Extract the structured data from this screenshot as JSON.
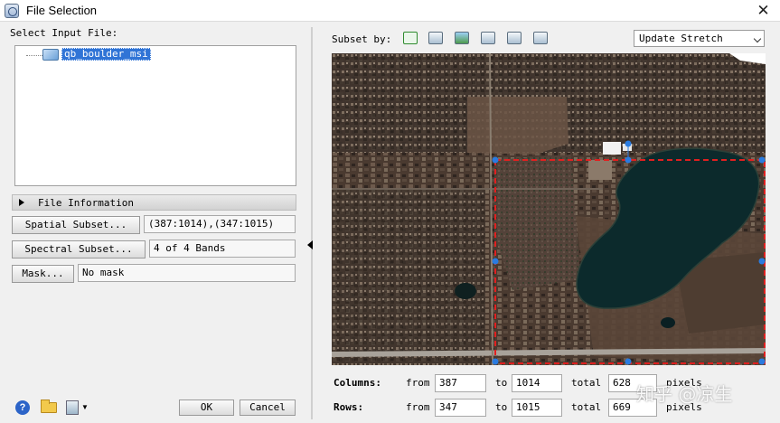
{
  "window": {
    "title": "File Selection",
    "close_glyph": "✕"
  },
  "left": {
    "select_label": "Select Input File:",
    "files": [
      "qb_boulder_msi"
    ],
    "file_info_label": "File Information",
    "spatial_button": "Spatial Subset...",
    "spatial_value": "(387:1014),(347:1015)",
    "spectral_button": "Spectral Subset...",
    "spectral_value": "4 of 4 Bands",
    "mask_button": "Mask...",
    "mask_value": "No mask"
  },
  "footer": {
    "ok": "OK",
    "cancel": "Cancel",
    "help_glyph": "?"
  },
  "right": {
    "subset_by_label": "Subset by:",
    "toolbar_icons": [
      "image-rect-icon",
      "roi-icon",
      "image-icon",
      "vector-icon",
      "map-icon",
      "file-icon"
    ],
    "stretch_select": "Update Stretch",
    "columns": {
      "label": "Columns:",
      "from_label": "from",
      "from": "387",
      "to_label": "to",
      "to": "1014",
      "total_label": "total",
      "total": "628",
      "unit": "pixels"
    },
    "rows": {
      "label": "Rows:",
      "from_label": "from",
      "from": "347",
      "to_label": "to",
      "to": "1015",
      "total_label": "total",
      "total": "669",
      "unit": "pixels"
    }
  },
  "colors": {
    "selection": "#3074d6",
    "subset_box": "#e02020",
    "handle": "#2a7be0",
    "lake": "#0c2a2c"
  },
  "watermark": "知乎 @凉生"
}
